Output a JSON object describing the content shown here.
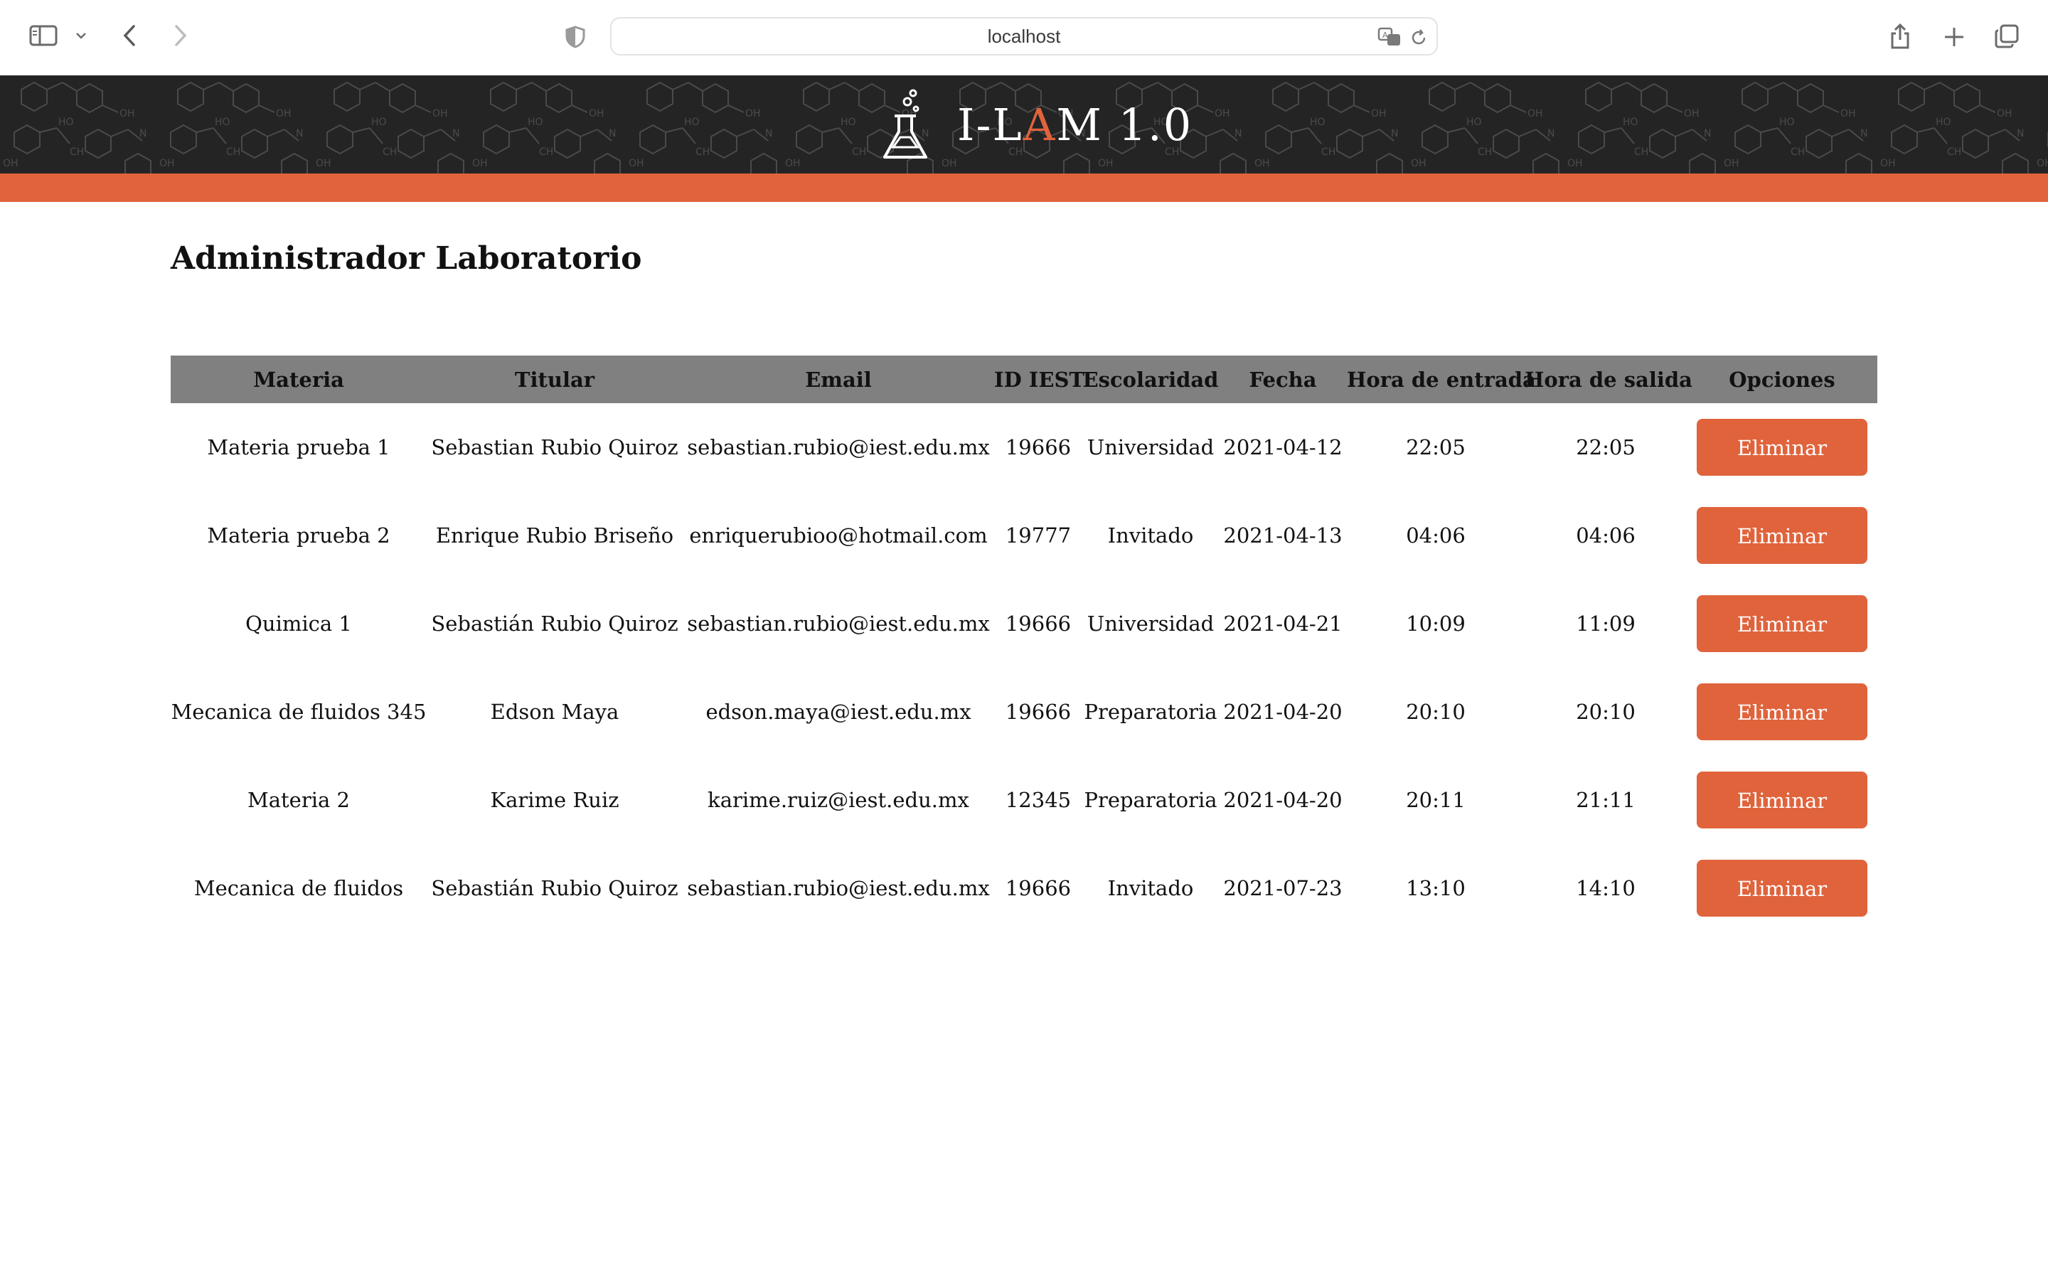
{
  "browser": {
    "url": "localhost"
  },
  "header": {
    "brand_prefix": "I-L",
    "brand_accent": "A",
    "brand_suffix": "M 1.0",
    "accent_color": "#e0633c",
    "background_color": "#242424"
  },
  "page": {
    "title": "Administrador Laboratorio"
  },
  "table": {
    "columns": [
      "Materia",
      "Titular",
      "Email",
      "ID IEST",
      "Escolaridad",
      "Fecha",
      "Hora de entrada",
      "Hora de salida",
      "Opciones"
    ],
    "delete_label": "Eliminar",
    "rows": [
      {
        "materia": "Materia prueba 1",
        "titular": "Sebastian Rubio Quiroz",
        "email": "sebastian.rubio@iest.edu.mx",
        "id": "19666",
        "escolaridad": "Universidad",
        "fecha": "2021-04-12",
        "entrada": "22:05",
        "salida": "22:05"
      },
      {
        "materia": "Materia prueba 2",
        "titular": "Enrique Rubio Briseño",
        "email": "enriquerubioo@hotmail.com",
        "id": "19777",
        "escolaridad": "Invitado",
        "fecha": "2021-04-13",
        "entrada": "04:06",
        "salida": "04:06"
      },
      {
        "materia": "Quimica 1",
        "titular": "Sebastián Rubio Quiroz",
        "email": "sebastian.rubio@iest.edu.mx",
        "id": "19666",
        "escolaridad": "Universidad",
        "fecha": "2021-04-21",
        "entrada": "10:09",
        "salida": "11:09"
      },
      {
        "materia": "Mecanica de fluidos 345",
        "titular": "Edson Maya",
        "email": "edson.maya@iest.edu.mx",
        "id": "19666",
        "escolaridad": "Preparatoria",
        "fecha": "2021-04-20",
        "entrada": "20:10",
        "salida": "20:10"
      },
      {
        "materia": "Materia 2",
        "titular": "Karime Ruiz",
        "email": "karime.ruiz@iest.edu.mx",
        "id": "12345",
        "escolaridad": "Preparatoria",
        "fecha": "2021-04-20",
        "entrada": "20:11",
        "salida": "21:11"
      },
      {
        "materia": "Mecanica de fluidos",
        "titular": "Sebastián Rubio Quiroz",
        "email": "sebastian.rubio@iest.edu.mx",
        "id": "19666",
        "escolaridad": "Invitado",
        "fecha": "2021-07-23",
        "entrada": "13:10",
        "salida": "14:10"
      }
    ]
  }
}
